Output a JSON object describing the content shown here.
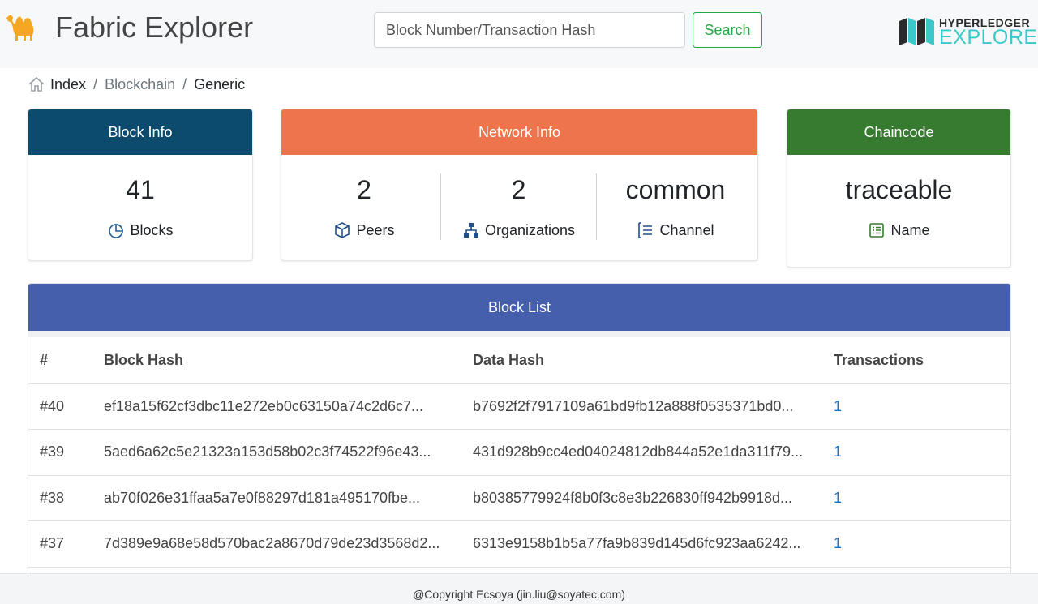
{
  "header": {
    "app_title": "Fabric Explorer",
    "search_placeholder": "Block Number/Transaction Hash",
    "search_button": "Search",
    "logo_top": "HYPERLEDGER",
    "logo_bottom": "EXPLORER"
  },
  "breadcrumb": [
    "Index",
    "Blockchain",
    "Generic"
  ],
  "block_info": {
    "title": "Block Info",
    "value": "41",
    "label": "Blocks",
    "color": "#0c4a6e"
  },
  "network_info": {
    "title": "Network Info",
    "color": "#ee744b",
    "stats": [
      {
        "value": "2",
        "label": "Peers",
        "icon": "cube-icon"
      },
      {
        "value": "2",
        "label": "Organizations",
        "icon": "sitemap-icon"
      },
      {
        "value": "common",
        "label": "Channel",
        "icon": "list-icon"
      }
    ]
  },
  "chaincode": {
    "title": "Chaincode",
    "value": "traceable",
    "label": "Name",
    "color": "#367b2f"
  },
  "block_list": {
    "title": "Block List",
    "color": "#465fad",
    "columns": [
      "#",
      "Block Hash",
      "Data Hash",
      "Transactions"
    ],
    "rows": [
      {
        "num": "#40",
        "block_hash": "ef18a15f62cf3dbc11e272eb0c63150a74c2d6c7...",
        "data_hash": "b7692f2f7917109a61bd9fb12a888f0535371bd0...",
        "tx": "1"
      },
      {
        "num": "#39",
        "block_hash": "5aed6a62c5e21323a153d58b02c3f74522f96e43...",
        "data_hash": "431d928b9cc4ed04024812db844a52e1da311f79...",
        "tx": "1"
      },
      {
        "num": "#38",
        "block_hash": "ab70f026e31ffaa5a7e0f88297d181a495170fbe...",
        "data_hash": "b80385779924f8b0f3c8e3b226830ff942b9918d...",
        "tx": "1"
      },
      {
        "num": "#37",
        "block_hash": "7d389e9a68e58d570bac2a8670d79de23d3568d2...",
        "data_hash": "6313e9158b1b5a77fa9b839d145d6fc923aa6242...",
        "tx": "1"
      }
    ]
  },
  "footer": {
    "text": "@Copyright Ecsoya (jin.liu@soyatec.com)"
  }
}
